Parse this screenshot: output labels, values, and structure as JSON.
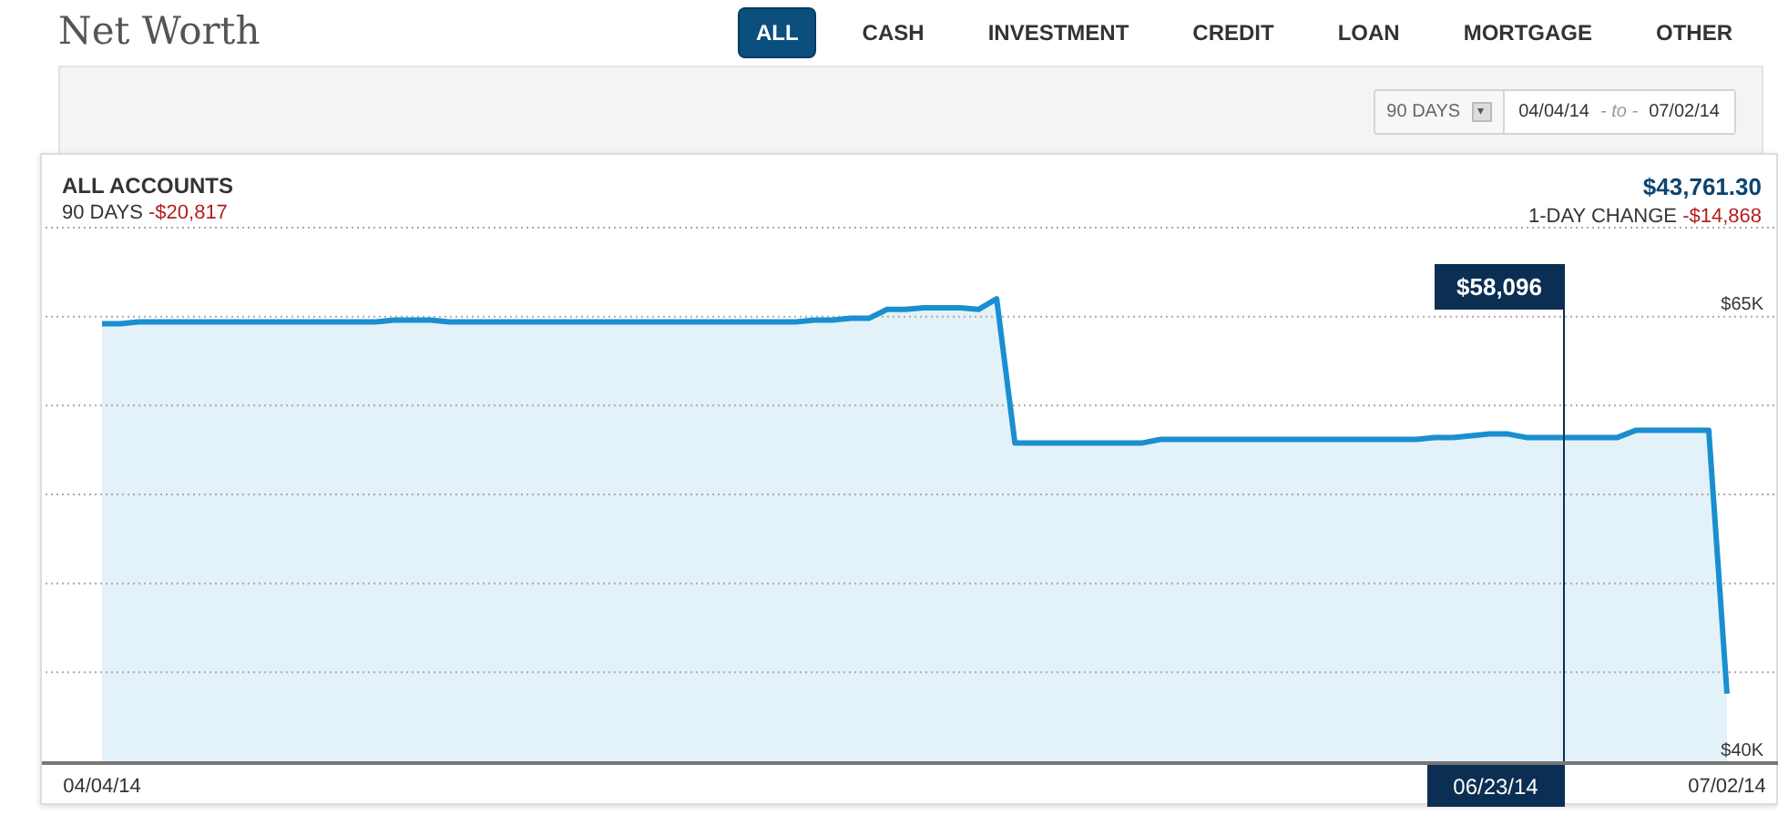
{
  "page_title": "Net Worth",
  "tabs": [
    {
      "label": "ALL",
      "selected": true
    },
    {
      "label": "CASH",
      "selected": false
    },
    {
      "label": "INVESTMENT",
      "selected": false
    },
    {
      "label": "CREDIT",
      "selected": false
    },
    {
      "label": "LOAN",
      "selected": false
    },
    {
      "label": "MORTGAGE",
      "selected": false
    },
    {
      "label": "OTHER",
      "selected": false
    }
  ],
  "range": {
    "period": "90 DAYS",
    "caret": "▾",
    "from": "04/04/14",
    "separator": "- to -",
    "to": "07/02/14"
  },
  "summary": {
    "title": "ALL ACCOUNTS",
    "period_label": "90 DAYS",
    "period_change": "-$20,817",
    "balance": "$43,761.30",
    "day_change_label": "1-DAY CHANGE",
    "day_change": "-$14,868"
  },
  "chart_data": {
    "type": "area",
    "categories": [
      "04/04/14",
      null,
      null,
      null,
      null,
      null,
      null,
      null,
      null,
      null,
      null,
      null,
      null,
      null,
      null,
      null,
      null,
      null,
      null,
      null,
      null,
      null,
      null,
      null,
      null,
      null,
      null,
      null,
      null,
      null,
      null,
      null,
      null,
      null,
      null,
      null,
      null,
      null,
      null,
      null,
      null,
      null,
      null,
      null,
      null,
      null,
      null,
      null,
      null,
      null,
      null,
      null,
      null,
      null,
      null,
      null,
      null,
      null,
      null,
      null,
      null,
      null,
      null,
      null,
      null,
      null,
      null,
      null,
      null,
      null,
      null,
      null,
      null,
      null,
      null,
      null,
      null,
      null,
      null,
      null,
      null,
      null,
      null,
      null,
      null,
      null,
      null,
      null,
      null,
      "07/02/14"
    ],
    "series": [
      {
        "color": "#1a8fd0",
        "values": [
          64.6,
          64.6,
          64.7,
          64.7,
          64.7,
          64.7,
          64.7,
          64.7,
          64.7,
          64.7,
          64.7,
          64.7,
          64.7,
          64.7,
          64.7,
          64.7,
          64.8,
          64.8,
          64.8,
          64.7,
          64.7,
          64.7,
          64.7,
          64.7,
          64.7,
          64.7,
          64.7,
          64.7,
          64.7,
          64.7,
          64.7,
          64.7,
          64.7,
          64.7,
          64.7,
          64.7,
          64.7,
          64.7,
          64.7,
          64.8,
          64.8,
          64.9,
          64.9,
          65.4,
          65.4,
          65.5,
          65.5,
          65.5,
          65.4,
          66.0,
          57.9,
          57.9,
          57.9,
          57.9,
          57.9,
          57.9,
          57.9,
          57.9,
          58.1,
          58.1,
          58.1,
          58.1,
          58.1,
          58.1,
          58.1,
          58.1,
          58.1,
          58.1,
          58.1,
          58.1,
          58.1,
          58.1,
          58.1,
          58.2,
          58.2,
          58.3,
          58.4,
          58.4,
          58.2,
          58.2,
          58.2,
          58.2,
          58.2,
          58.2,
          58.6,
          58.6,
          58.6,
          58.6,
          58.6,
          43.8
        ]
      }
    ],
    "ylim": [
      40,
      70
    ],
    "yticks": [
      {
        "value": 40,
        "label": "$40K"
      },
      {
        "value": 65,
        "label": "$65K"
      }
    ],
    "annotations": [
      "$58,096",
      "06/23/14"
    ]
  }
}
